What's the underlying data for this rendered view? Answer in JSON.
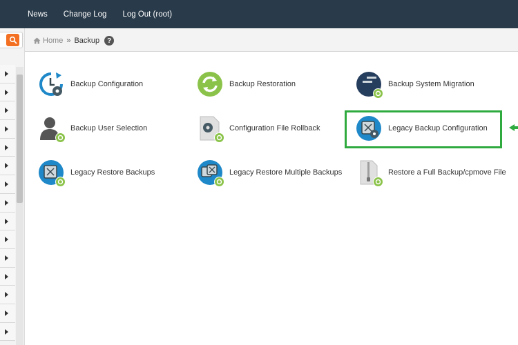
{
  "topnav": {
    "items": [
      "News",
      "Change Log",
      "Log Out (root)"
    ]
  },
  "breadcrumb": {
    "home": "Home",
    "separator": "»",
    "current": "Backup",
    "help": "?"
  },
  "tiles": [
    {
      "label": "Backup Configuration",
      "icon": "backup-configuration-icon"
    },
    {
      "label": "Backup Restoration",
      "icon": "backup-restoration-icon"
    },
    {
      "label": "Backup System Migration",
      "icon": "backup-system-migration-icon"
    },
    {
      "label": "Backup User Selection",
      "icon": "backup-user-selection-icon"
    },
    {
      "label": "Configuration File Rollback",
      "icon": "configuration-file-rollback-icon"
    },
    {
      "label": "Legacy Backup Configuration",
      "icon": "legacy-backup-configuration-icon"
    },
    {
      "label": "Legacy Restore Backups",
      "icon": "legacy-restore-backups-icon"
    },
    {
      "label": "Legacy Restore Multiple Backups",
      "icon": "legacy-restore-multiple-backups-icon"
    },
    {
      "label": "Restore a Full Backup/cpmove File",
      "icon": "restore-full-backup-icon"
    }
  ],
  "colors": {
    "topbar": "#293a4a",
    "accent_orange": "#f36f21",
    "badge_green": "#8bc34a",
    "highlight_green": "#2eaa3f",
    "icon_blue": "#1e88c8"
  }
}
